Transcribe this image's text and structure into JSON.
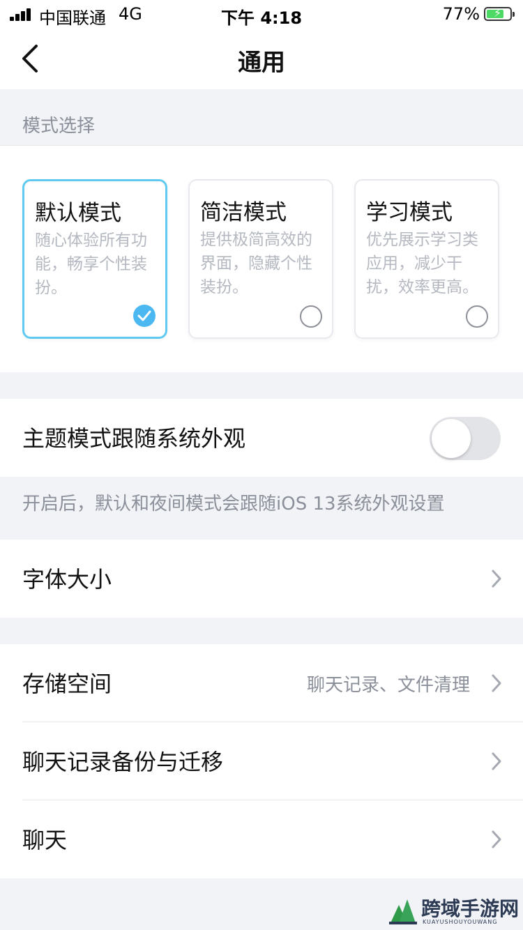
{
  "status_bar": {
    "carrier": "中国联通",
    "network": "4G",
    "time": "下午 4:18",
    "battery": "77%",
    "battery_level": 0.77
  },
  "nav": {
    "title": "通用",
    "back_icon": "chevron-left-icon"
  },
  "mode_section": {
    "header": "模式选择",
    "cards": [
      {
        "title": "默认模式",
        "desc": "随心体验所有功能，畅享个性装扮。",
        "selected": true
      },
      {
        "title": "简洁模式",
        "desc": "提供极简高效的界面，隐藏个性装扮。",
        "selected": false
      },
      {
        "title": "学习模式",
        "desc": "优先展示学习类应用，减少干扰，效率更高。",
        "selected": false
      }
    ]
  },
  "theme_follow": {
    "label": "主题模式跟随系统外观",
    "enabled": false,
    "hint": "开启后，默认和夜间模式会跟随iOS 13系统外观设置"
  },
  "font_size": {
    "label": "字体大小"
  },
  "storage": {
    "label": "存储空间",
    "sub": "聊天记录、文件清理"
  },
  "backup": {
    "label": "聊天记录备份与迁移"
  },
  "chat": {
    "label": "聊天"
  },
  "watermark": {
    "text": "跨域手游网",
    "sub": "KUAYUSHOUYOUWANG"
  },
  "colors": {
    "accent": "#4bb8f2",
    "selected_border": "#5fcaf0",
    "background": "#f2f3f7"
  }
}
